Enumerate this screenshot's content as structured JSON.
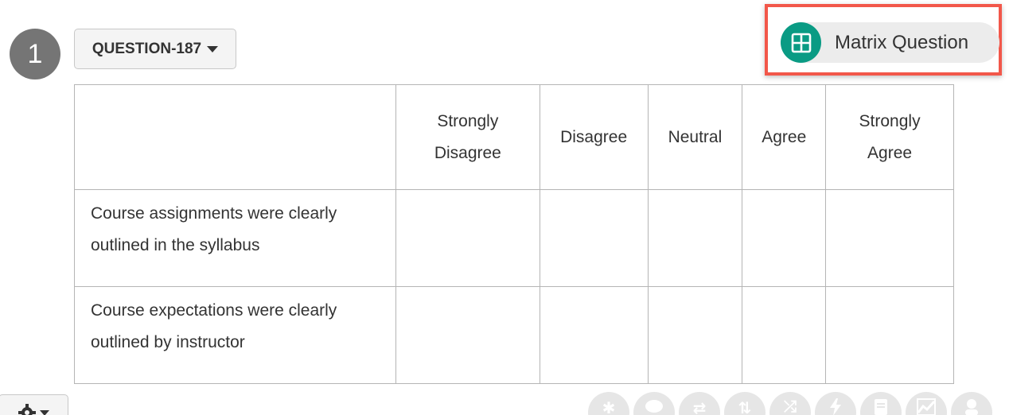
{
  "question": {
    "number": "1",
    "id_label": "QUESTION-187",
    "type_label": "Matrix Question"
  },
  "colors": {
    "type_icon_bg": "#0a9b84",
    "highlight_border": "#f2574a",
    "number_badge_bg": "#757575"
  },
  "matrix": {
    "columns": [
      "Strongly Disagree",
      "Disagree",
      "Neutral",
      "Agree",
      "Strongly Agree"
    ],
    "rows": [
      "Course assignments were clearly outlined in the syllabus",
      "Course expectations were clearly outlined by instructor"
    ]
  },
  "toolbar": {
    "icons": [
      "asterisk-icon",
      "comment-icon",
      "swap-icon",
      "sort-icon",
      "shuffle-icon",
      "lightning-icon",
      "document-icon",
      "chart-icon",
      "person-icon"
    ]
  }
}
